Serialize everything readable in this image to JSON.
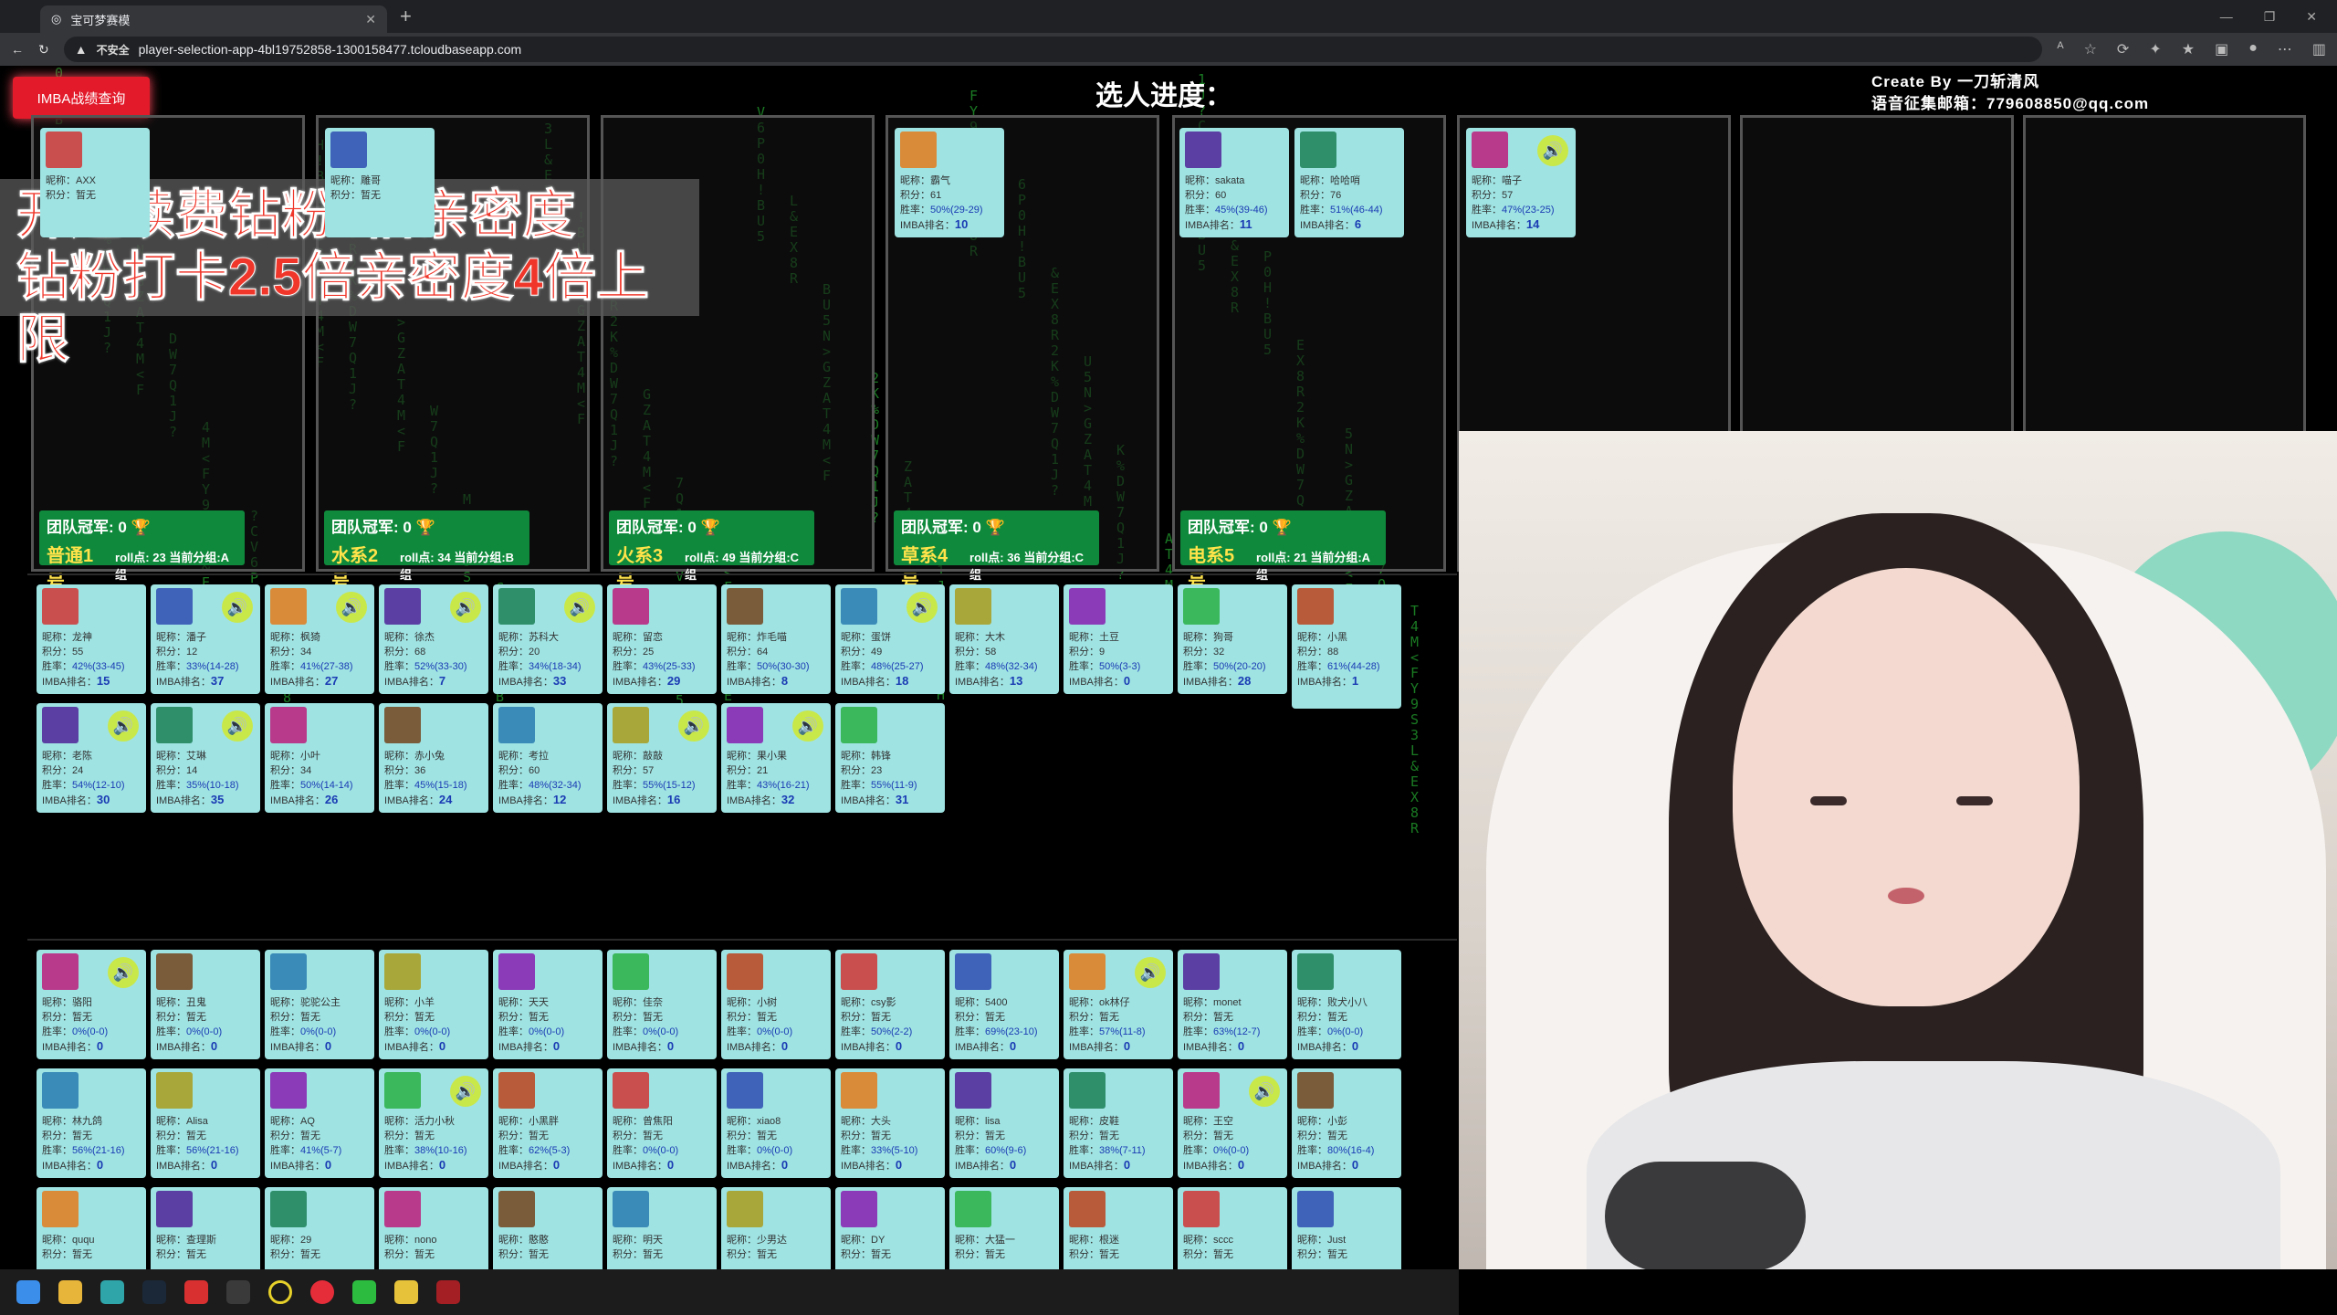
{
  "browser": {
    "tab_title": "宝可梦赛模",
    "url_warning": "不安全",
    "url": "player-selection-app-4bl19752858-1300158477.tcloudbaseapp.com"
  },
  "header": {
    "imba_button": "IMBA战绩查询",
    "progress_title": "选人进度：",
    "credit_line1": "Create By 一刀斩清风",
    "credit_line2": "语音征集邮箱：779608850@qq.com"
  },
  "banner": {
    "line1": "开通续费钻粉5倍亲密度",
    "line2": "钻粉打卡2.5倍亲密度4倍上限"
  },
  "labels": {
    "nick": "昵称：",
    "score": "积分：",
    "winrate": "胜率：",
    "rank": "IMBA排名：",
    "none": "暂无",
    "champ": "团队冠军: 0",
    "roll": "roll点:",
    "group_prefix": "当前分组:"
  },
  "teams": [
    {
      "name": "普通1号",
      "roll": "23",
      "group": "A组"
    },
    {
      "name": "水系2号",
      "roll": "34",
      "group": "B组"
    },
    {
      "name": "火系3号",
      "roll": "49",
      "group": "C组"
    },
    {
      "name": "草系4号",
      "roll": "36",
      "group": "C组"
    },
    {
      "name": "电系5号",
      "roll": "21",
      "group": "A组"
    }
  ],
  "team_members": [
    {
      "nick": "AXX"
    },
    {
      "nick": "雕哥"
    },
    {
      "nick": "霸气",
      "score": "61",
      "winrate": "50%(29-29)",
      "rank": "10"
    },
    {
      "nick": "sakata",
      "score": "60",
      "winrate": "45%(39-46)",
      "rank": "11"
    },
    {
      "nick": "哈哈哨",
      "score": "76",
      "winrate": "51%(46-44)",
      "rank": "6"
    },
    {
      "nick": "喵子",
      "score": "57",
      "winrate": "47%(23-25)",
      "rank": "14"
    }
  ],
  "pool_row1": [
    {
      "nick": "龙神",
      "score": "55",
      "winrate": "42%(33-45)",
      "rank": "15"
    },
    {
      "nick": "潘子",
      "score": "12",
      "winrate": "33%(14-28)",
      "rank": "37"
    },
    {
      "nick": "枫猗",
      "score": "34",
      "winrate": "41%(27-38)",
      "rank": "27"
    },
    {
      "nick": "徐杰",
      "score": "68",
      "winrate": "52%(33-30)",
      "rank": "7"
    },
    {
      "nick": "苏科大",
      "score": "20",
      "winrate": "34%(18-34)",
      "rank": "33"
    },
    {
      "nick": "留恋",
      "score": "25",
      "winrate": "43%(25-33)",
      "rank": "29"
    },
    {
      "nick": "炸毛喵",
      "score": "64",
      "winrate": "50%(30-30)",
      "rank": "8"
    },
    {
      "nick": "蛋饼",
      "score": "49",
      "winrate": "48%(25-27)",
      "rank": "18"
    },
    {
      "nick": "大木",
      "score": "58",
      "winrate": "48%(32-34)",
      "rank": "13"
    },
    {
      "nick": "土豆",
      "score": "9",
      "winrate": "50%(3-3)",
      "rank": "0"
    },
    {
      "nick": "狗哥",
      "score": "32",
      "winrate": "50%(20-20)",
      "rank": "28"
    },
    {
      "nick": "小黑",
      "score": "88",
      "winrate": "61%(44-28)",
      "rank": "1"
    }
  ],
  "pool_row2": [
    {
      "nick": "老陈",
      "score": "24",
      "winrate": "54%(12-10)",
      "rank": "30"
    },
    {
      "nick": "艾琳",
      "score": "14",
      "winrate": "35%(10-18)",
      "rank": "35"
    },
    {
      "nick": "小叶",
      "score": "34",
      "winrate": "50%(14-14)",
      "rank": "26"
    },
    {
      "nick": "赤小兔",
      "score": "36",
      "winrate": "45%(15-18)",
      "rank": "24"
    },
    {
      "nick": "考拉",
      "score": "60",
      "winrate": "48%(32-34)",
      "rank": "12"
    },
    {
      "nick": "敲敲",
      "score": "57",
      "winrate": "55%(15-12)",
      "rank": "16"
    },
    {
      "nick": "果小果",
      "score": "21",
      "winrate": "43%(16-21)",
      "rank": "32"
    },
    {
      "nick": "韩锋",
      "score": "23",
      "winrate": "55%(11-9)",
      "rank": "31"
    }
  ],
  "new_row1": [
    {
      "nick": "骆阳",
      "winrate": "0%(0-0)"
    },
    {
      "nick": "丑鬼",
      "winrate": "0%(0-0)"
    },
    {
      "nick": "驼驼公主",
      "winrate": "0%(0-0)"
    },
    {
      "nick": "小羊",
      "winrate": "0%(0-0)"
    },
    {
      "nick": "天天",
      "winrate": "0%(0-0)"
    },
    {
      "nick": "佳奈",
      "winrate": "0%(0-0)"
    },
    {
      "nick": "小树",
      "winrate": "0%(0-0)"
    },
    {
      "nick": "csy影",
      "winrate": "50%(2-2)"
    },
    {
      "nick": "5400",
      "winrate": "69%(23-10)"
    },
    {
      "nick": "ok林仔",
      "winrate": "57%(11-8)"
    },
    {
      "nick": "monet",
      "winrate": "63%(12-7)"
    },
    {
      "nick": "败犬小八",
      "winrate": "0%(0-0)"
    }
  ],
  "new_row2": [
    {
      "nick": "林九鸽",
      "winrate": "56%(21-16)"
    },
    {
      "nick": "Alisa",
      "winrate": "56%(21-16)"
    },
    {
      "nick": "AQ",
      "winrate": "41%(5-7)"
    },
    {
      "nick": "活力小秋",
      "winrate": "38%(10-16)"
    },
    {
      "nick": "小黑胖",
      "winrate": "62%(5-3)"
    },
    {
      "nick": "曾焦阳",
      "winrate": "0%(0-0)"
    },
    {
      "nick": "xiao8",
      "winrate": "0%(0-0)"
    },
    {
      "nick": "大头",
      "winrate": "33%(5-10)"
    },
    {
      "nick": "lisa",
      "winrate": "60%(9-6)"
    },
    {
      "nick": "皮鞋",
      "winrate": "38%(7-11)"
    },
    {
      "nick": "王空",
      "winrate": "0%(0-0)"
    },
    {
      "nick": "小彭",
      "winrate": "80%(16-4)"
    }
  ],
  "new_row3": [
    {
      "nick": "ququ"
    },
    {
      "nick": "查理斯"
    },
    {
      "nick": "29"
    },
    {
      "nick": "nono"
    },
    {
      "nick": "憨憨"
    },
    {
      "nick": "明天"
    },
    {
      "nick": "少男达"
    },
    {
      "nick": "DY"
    },
    {
      "nick": "大猛一"
    },
    {
      "nick": "根迷"
    },
    {
      "nick": "sccc"
    },
    {
      "nick": "Just"
    }
  ]
}
